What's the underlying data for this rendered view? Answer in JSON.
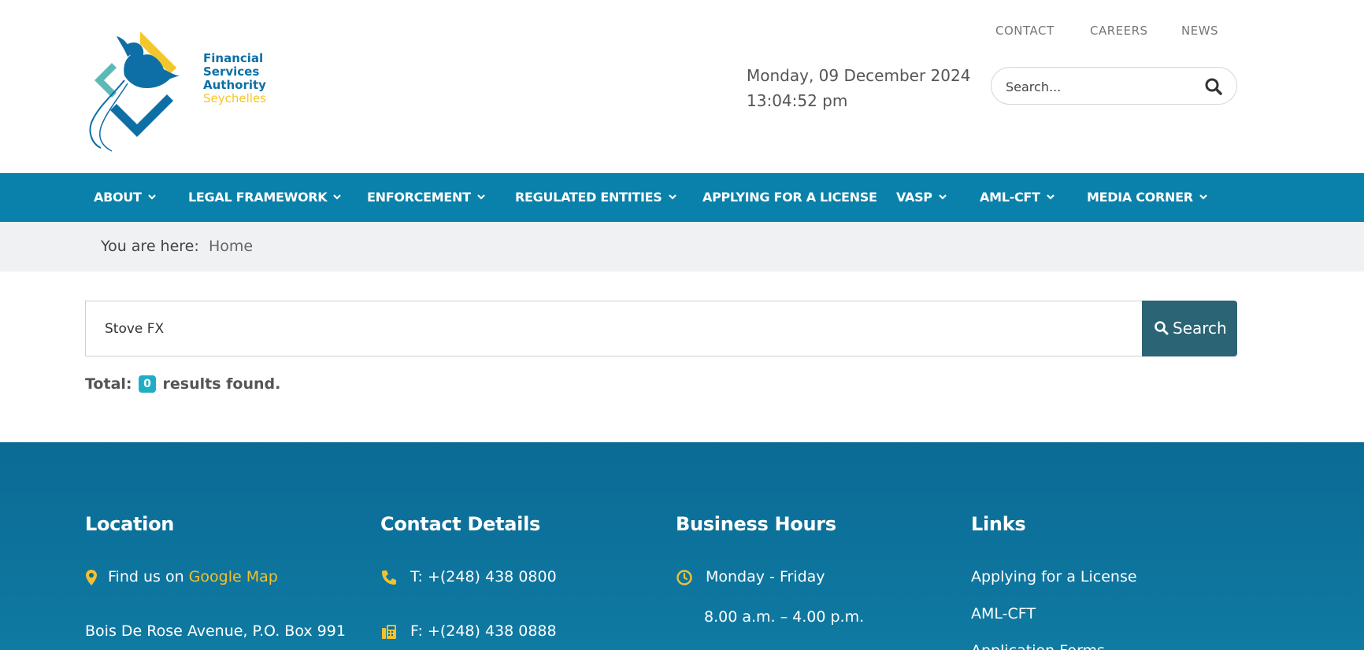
{
  "colors": {
    "nav_bg": "#0a81aa",
    "footer_bg": "#0b6b95",
    "accent_yellow": "#f2c12e",
    "search_button": "#2b6474",
    "badge": "#1faec6"
  },
  "logo": {
    "line1": "Financial",
    "line2": "Services",
    "line3": "Authority",
    "line4": "Seychelles"
  },
  "top_links": [
    "CONTACT",
    "CAREERS",
    "NEWS"
  ],
  "datetime": {
    "date": "Monday, 09 December 2024",
    "time": "13:04:52 pm"
  },
  "header_search": {
    "placeholder": "Search...",
    "icon": "search-icon"
  },
  "nav": [
    {
      "label": "ABOUT",
      "dropdown": true
    },
    {
      "label": "LEGAL FRAMEWORK",
      "dropdown": true
    },
    {
      "label": "ENFORCEMENT",
      "dropdown": true
    },
    {
      "label": "REGULATED ENTITIES",
      "dropdown": true
    },
    {
      "label": "APPLYING FOR A LICENSE",
      "dropdown": false
    },
    {
      "label": "VASP",
      "dropdown": true
    },
    {
      "label": "AML-CFT",
      "dropdown": true
    },
    {
      "label": "MEDIA CORNER",
      "dropdown": true
    }
  ],
  "breadcrumb": {
    "label": "You are here:",
    "home": "Home"
  },
  "search": {
    "value": "Stove FX",
    "button_label": "Search",
    "total_prefix": "Total:",
    "count": "0",
    "total_suffix": "results found."
  },
  "footer": {
    "location": {
      "title": "Location",
      "find_prefix": "Find us on",
      "map_link": "Google Map",
      "address": "Bois De Rose Avenue, P.O. Box 991"
    },
    "contact": {
      "title": "Contact Details",
      "phone": "T: +(248) 438 0800",
      "fax": "F: +(248) 438 0888"
    },
    "hours": {
      "title": "Business Hours",
      "days": "Monday - Friday",
      "time": "8.00 a.m. – 4.00 p.m."
    },
    "links": {
      "title": "Links",
      "items": [
        "Applying for a License",
        "AML-CFT",
        "Application Forms"
      ]
    }
  }
}
